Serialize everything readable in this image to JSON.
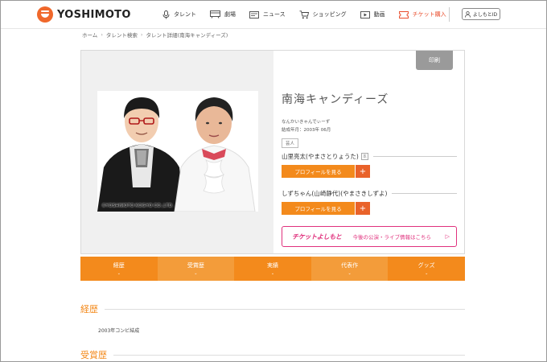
{
  "header": {
    "logo_text": "YOSHIMOTO",
    "nav": [
      {
        "label": "タレント",
        "icon": "microphone-icon"
      },
      {
        "label": "劇場",
        "icon": "theater-icon"
      },
      {
        "label": "ニュース",
        "icon": "news-icon"
      },
      {
        "label": "ショッピング",
        "icon": "cart-icon"
      },
      {
        "label": "動画",
        "icon": "video-icon"
      },
      {
        "label": "チケット購入",
        "icon": "ticket-icon"
      }
    ],
    "login_label": "よしもとID"
  },
  "breadcrumb": [
    "ホーム",
    "タレント検索",
    "タレント詳細(南海キャンディーズ)"
  ],
  "profile": {
    "print_label": "印刷",
    "name": "南海キャンディーズ",
    "kana": "なんかいきゃんでぃーず",
    "formed": "結成年月：2003年 06月",
    "tag": "芸人",
    "copyright": "©YOSHIMOTO KOGYO CO.,LTD.",
    "members": [
      {
        "name": "山里亮太(やまさとりょうた)",
        "badge": "本",
        "button_label": "プロフィールを見る",
        "plus": "+"
      },
      {
        "name": "しずちゃん(山崎静代)(やまさきしずよ)",
        "badge": "",
        "button_label": "プロフィールを見る",
        "plus": "+"
      }
    ],
    "ticket_banner": {
      "logo": "チケットよしもと",
      "text": "今後の公演・ライブ情報はこちら",
      "arrow": "▷"
    }
  },
  "tabs": [
    {
      "label": "経歴",
      "chevron": "⌄"
    },
    {
      "label": "受賞歴",
      "chevron": "⌄"
    },
    {
      "label": "実績",
      "chevron": "⌄"
    },
    {
      "label": "代表作",
      "chevron": "⌄"
    },
    {
      "label": "グッズ",
      "chevron": "⌄"
    }
  ],
  "sections": {
    "career_title": "経歴",
    "career_text": "2003年コンビ結成",
    "awards_title": "受賞歴"
  },
  "colors": {
    "brand_orange": "#f38a1c",
    "ticket_pink": "#e0317d",
    "logo_red": "#f0682b"
  }
}
